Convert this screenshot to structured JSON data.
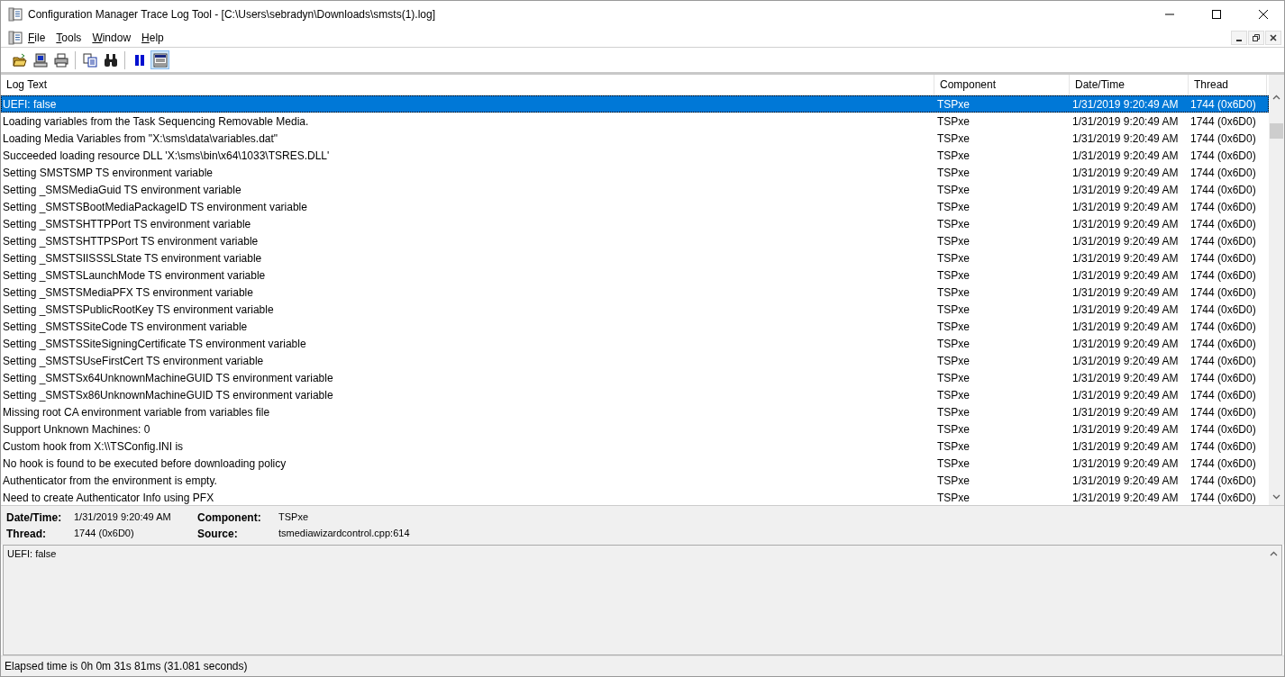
{
  "window": {
    "title": "Configuration Manager Trace Log Tool - [C:\\Users\\sebradyn\\Downloads\\smsts(1).log]"
  },
  "menu": [
    {
      "label": "File"
    },
    {
      "label": "Tools"
    },
    {
      "label": "Window"
    },
    {
      "label": "Help"
    }
  ],
  "toolbar": [
    {
      "kind": "open",
      "pressed": false
    },
    {
      "kind": "computer",
      "pressed": false
    },
    {
      "kind": "print",
      "pressed": false
    },
    {
      "kind": "separator"
    },
    {
      "kind": "copy",
      "pressed": false
    },
    {
      "kind": "find",
      "pressed": false
    },
    {
      "kind": "separator"
    },
    {
      "kind": "pause",
      "pressed": false
    },
    {
      "kind": "pane",
      "pressed": true
    }
  ],
  "table": {
    "columns": [
      "Log Text",
      "Component",
      "Date/Time",
      "Thread"
    ],
    "rows": [
      {
        "text": "UEFI: false",
        "component": "TSPxe",
        "datetime": "1/31/2019 9:20:49 AM",
        "thread": "1744 (0x6D0)",
        "selected": true
      },
      {
        "text": "Loading variables from the Task Sequencing Removable Media.",
        "component": "TSPxe",
        "datetime": "1/31/2019 9:20:49 AM",
        "thread": "1744 (0x6D0)",
        "selected": false
      },
      {
        "text": "Loading Media Variables from \"X:\\sms\\data\\variables.dat\"",
        "component": "TSPxe",
        "datetime": "1/31/2019 9:20:49 AM",
        "thread": "1744 (0x6D0)",
        "selected": false
      },
      {
        "text": "Succeeded loading resource DLL 'X:\\sms\\bin\\x64\\1033\\TSRES.DLL'",
        "component": "TSPxe",
        "datetime": "1/31/2019 9:20:49 AM",
        "thread": "1744 (0x6D0)",
        "selected": false
      },
      {
        "text": "Setting SMSTSMP TS environment variable",
        "component": "TSPxe",
        "datetime": "1/31/2019 9:20:49 AM",
        "thread": "1744 (0x6D0)",
        "selected": false
      },
      {
        "text": "Setting _SMSMediaGuid TS environment variable",
        "component": "TSPxe",
        "datetime": "1/31/2019 9:20:49 AM",
        "thread": "1744 (0x6D0)",
        "selected": false
      },
      {
        "text": "Setting _SMSTSBootMediaPackageID TS environment variable",
        "component": "TSPxe",
        "datetime": "1/31/2019 9:20:49 AM",
        "thread": "1744 (0x6D0)",
        "selected": false
      },
      {
        "text": "Setting _SMSTSHTTPPort TS environment variable",
        "component": "TSPxe",
        "datetime": "1/31/2019 9:20:49 AM",
        "thread": "1744 (0x6D0)",
        "selected": false
      },
      {
        "text": "Setting _SMSTSHTTPSPort TS environment variable",
        "component": "TSPxe",
        "datetime": "1/31/2019 9:20:49 AM",
        "thread": "1744 (0x6D0)",
        "selected": false
      },
      {
        "text": "Setting _SMSTSIISSSLState TS environment variable",
        "component": "TSPxe",
        "datetime": "1/31/2019 9:20:49 AM",
        "thread": "1744 (0x6D0)",
        "selected": false
      },
      {
        "text": "Setting _SMSTSLaunchMode TS environment variable",
        "component": "TSPxe",
        "datetime": "1/31/2019 9:20:49 AM",
        "thread": "1744 (0x6D0)",
        "selected": false
      },
      {
        "text": "Setting _SMSTSMediaPFX TS environment variable",
        "component": "TSPxe",
        "datetime": "1/31/2019 9:20:49 AM",
        "thread": "1744 (0x6D0)",
        "selected": false
      },
      {
        "text": "Setting _SMSTSPublicRootKey TS environment variable",
        "component": "TSPxe",
        "datetime": "1/31/2019 9:20:49 AM",
        "thread": "1744 (0x6D0)",
        "selected": false
      },
      {
        "text": "Setting _SMSTSSiteCode TS environment variable",
        "component": "TSPxe",
        "datetime": "1/31/2019 9:20:49 AM",
        "thread": "1744 (0x6D0)",
        "selected": false
      },
      {
        "text": "Setting _SMSTSSiteSigningCertificate TS environment variable",
        "component": "TSPxe",
        "datetime": "1/31/2019 9:20:49 AM",
        "thread": "1744 (0x6D0)",
        "selected": false
      },
      {
        "text": "Setting _SMSTSUseFirstCert TS environment variable",
        "component": "TSPxe",
        "datetime": "1/31/2019 9:20:49 AM",
        "thread": "1744 (0x6D0)",
        "selected": false
      },
      {
        "text": "Setting _SMSTSx64UnknownMachineGUID TS environment variable",
        "component": "TSPxe",
        "datetime": "1/31/2019 9:20:49 AM",
        "thread": "1744 (0x6D0)",
        "selected": false
      },
      {
        "text": "Setting _SMSTSx86UnknownMachineGUID TS environment variable",
        "component": "TSPxe",
        "datetime": "1/31/2019 9:20:49 AM",
        "thread": "1744 (0x6D0)",
        "selected": false
      },
      {
        "text": "Missing root CA environment variable from variables file",
        "component": "TSPxe",
        "datetime": "1/31/2019 9:20:49 AM",
        "thread": "1744 (0x6D0)",
        "selected": false
      },
      {
        "text": "Support Unknown Machines: 0",
        "component": "TSPxe",
        "datetime": "1/31/2019 9:20:49 AM",
        "thread": "1744 (0x6D0)",
        "selected": false
      },
      {
        "text": "Custom hook from X:\\\\TSConfig.INI is",
        "component": "TSPxe",
        "datetime": "1/31/2019 9:20:49 AM",
        "thread": "1744 (0x6D0)",
        "selected": false
      },
      {
        "text": "No hook is found to be executed before downloading policy",
        "component": "TSPxe",
        "datetime": "1/31/2019 9:20:49 AM",
        "thread": "1744 (0x6D0)",
        "selected": false
      },
      {
        "text": "Authenticator from the environment is empty.",
        "component": "TSPxe",
        "datetime": "1/31/2019 9:20:49 AM",
        "thread": "1744 (0x6D0)",
        "selected": false
      },
      {
        "text": "Need to create Authenticator Info using PFX",
        "component": "TSPxe",
        "datetime": "1/31/2019 9:20:49 AM",
        "thread": "1744 (0x6D0)",
        "selected": false
      }
    ]
  },
  "details": [
    {
      "label": "Date/Time:",
      "value": "1/31/2019 9:20:49 AM"
    },
    {
      "label": "Component:",
      "value": "TSPxe"
    },
    {
      "label": "Thread:",
      "value": "1744 (0x6D0)"
    },
    {
      "label": "Source:",
      "value": "tsmediawizardcontrol.cpp:614"
    }
  ],
  "message": "UEFI: false",
  "status_bar": "Elapsed time is 0h 0m 31s 81ms (31.081 seconds)"
}
